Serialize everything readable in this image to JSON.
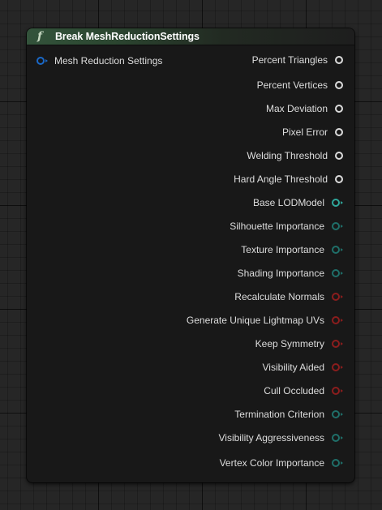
{
  "node": {
    "title": "Break MeshReductionSettings",
    "icon": "function-icon",
    "header_color": "#33533b",
    "input": {
      "label": "Mesh Reduction Settings",
      "color": "#1a68c7"
    },
    "outputs": [
      {
        "label": "Percent Triangles",
        "type": "float",
        "color": "#dcdcdc"
      },
      {
        "label": "Percent Vertices",
        "type": "float",
        "color": "#dcdcdc"
      },
      {
        "label": "Max Deviation",
        "type": "float",
        "color": "#dcdcdc"
      },
      {
        "label": "Pixel Error",
        "type": "float",
        "color": "#dcdcdc"
      },
      {
        "label": "Welding Threshold",
        "type": "float",
        "color": "#dcdcdc"
      },
      {
        "label": "Hard Angle Threshold",
        "type": "float",
        "color": "#dcdcdc"
      },
      {
        "label": "Base LODModel",
        "type": "int",
        "color": "#2fa79b"
      },
      {
        "label": "Silhouette Importance",
        "type": "enum",
        "color": "#1f6f69"
      },
      {
        "label": "Texture Importance",
        "type": "enum",
        "color": "#1f6f69"
      },
      {
        "label": "Shading Importance",
        "type": "enum",
        "color": "#1f6f69"
      },
      {
        "label": "Recalculate Normals",
        "type": "bool",
        "color": "#8b1d1d"
      },
      {
        "label": "Generate Unique Lightmap UVs",
        "type": "bool",
        "color": "#8b1d1d"
      },
      {
        "label": "Keep Symmetry",
        "type": "bool",
        "color": "#8b1d1d"
      },
      {
        "label": "Visibility Aided",
        "type": "bool",
        "color": "#8b1d1d"
      },
      {
        "label": "Cull Occluded",
        "type": "bool",
        "color": "#8b1d1d"
      },
      {
        "label": "Termination Criterion",
        "type": "enum",
        "color": "#1f6f69"
      },
      {
        "label": "Visibility Aggressiveness",
        "type": "enum",
        "color": "#1f6f69"
      },
      {
        "label": "Vertex Color Importance",
        "type": "enum",
        "color": "#1f6f69"
      }
    ]
  }
}
